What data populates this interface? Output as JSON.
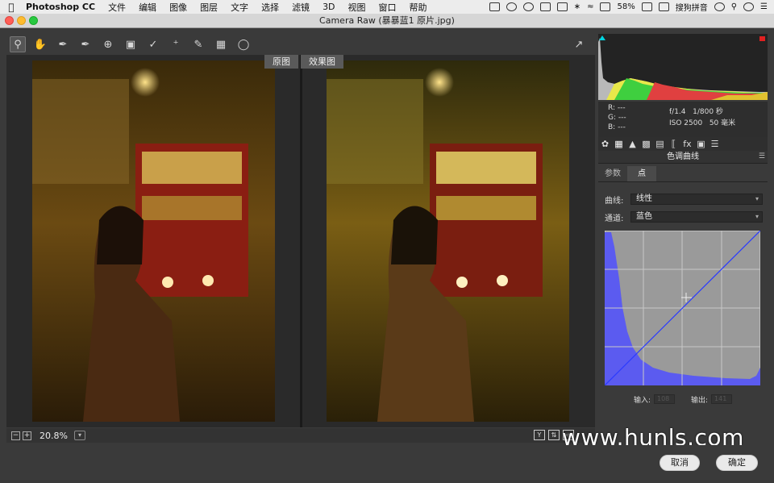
{
  "menubar": {
    "app_name": "Photoshop CC",
    "items": [
      "文件",
      "编辑",
      "图像",
      "图层",
      "文字",
      "选择",
      "滤镜",
      "3D",
      "视图",
      "窗口",
      "帮助"
    ],
    "battery": "58%",
    "input_method": "搜狗拼音"
  },
  "window": {
    "title": "Camera Raw (暴暴蓝1 原片.jpg)"
  },
  "preview": {
    "before_label": "原图",
    "after_label": "效果图"
  },
  "status": {
    "zoom": "20.8%"
  },
  "readout": {
    "r": "R:",
    "g": "G:",
    "b": "B:",
    "r_val": "---",
    "g_val": "---",
    "b_val": "---",
    "aperture": "f/1.4",
    "shutter": "1/800 秒",
    "iso": "ISO 2500",
    "focal": "50 毫米"
  },
  "panel": {
    "title": "色调曲线",
    "tabs": [
      "参数",
      "点"
    ],
    "curve_label": "曲线:",
    "curve_value": "线性",
    "channel_label": "通道:",
    "channel_value": "蓝色",
    "input_label": "输入:",
    "input_value": "108",
    "output_label": "输出:",
    "output_value": "141"
  },
  "buttons": {
    "cancel": "取消",
    "ok": "确定"
  },
  "watermark": "www.hunls.com",
  "colors": {
    "curve_fill": "#5b5bf0",
    "curve_bg": "#9a9a9a"
  }
}
